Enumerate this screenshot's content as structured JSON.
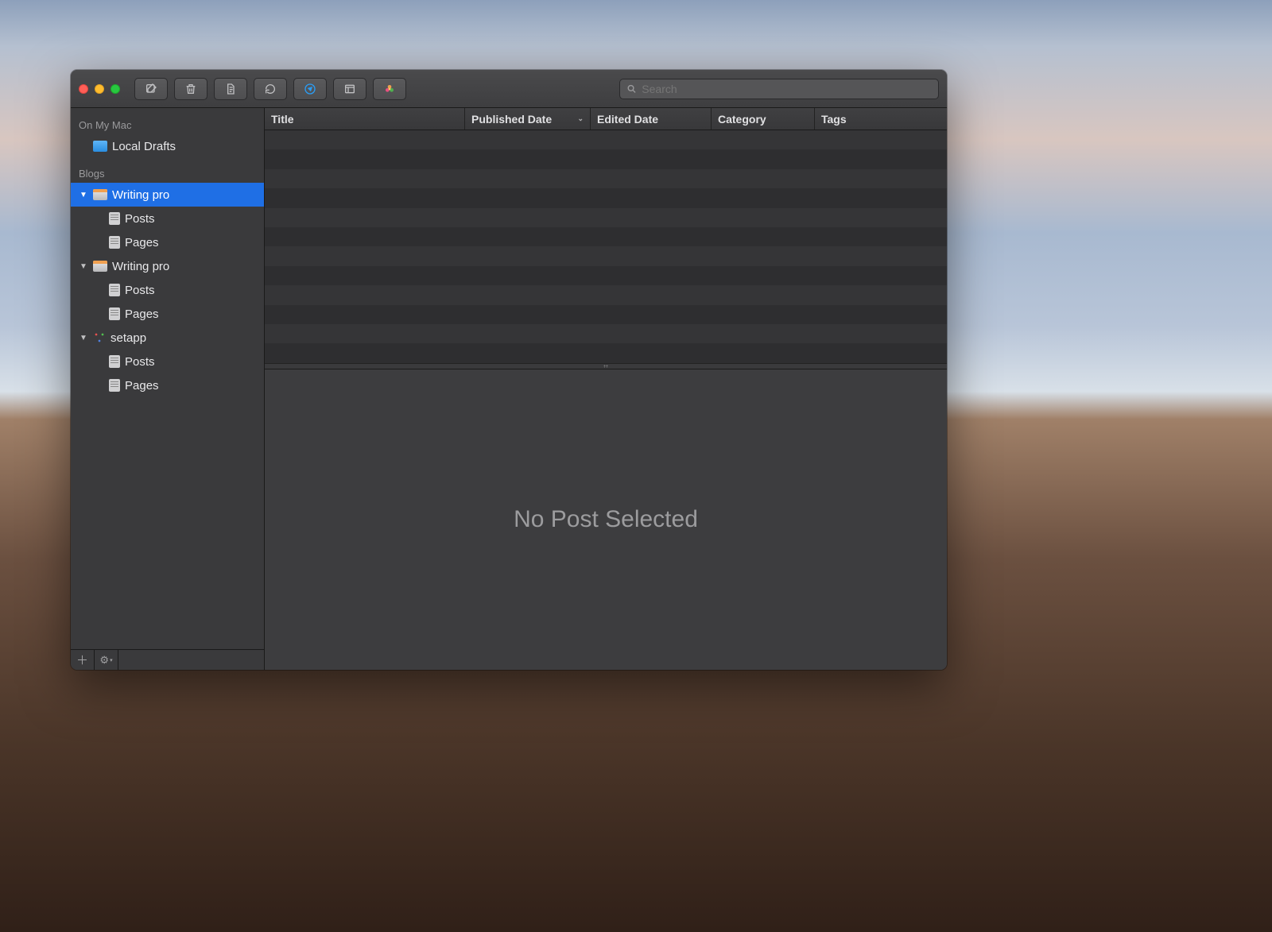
{
  "search": {
    "placeholder": "Search"
  },
  "sidebar": {
    "sections": [
      {
        "header": "On My Mac",
        "items": [
          {
            "label": "Local Drafts",
            "iconType": "folder"
          }
        ]
      },
      {
        "header": "Blogs",
        "items": [
          {
            "label": "Writing pro",
            "iconType": "blog",
            "expanded": true,
            "selected": true,
            "children": [
              {
                "label": "Posts"
              },
              {
                "label": "Pages"
              }
            ]
          },
          {
            "label": "Writing pro",
            "iconType": "blog",
            "expanded": true,
            "selected": false,
            "children": [
              {
                "label": "Posts"
              },
              {
                "label": "Pages"
              }
            ]
          },
          {
            "label": "setapp",
            "iconType": "setapp",
            "expanded": true,
            "selected": false,
            "children": [
              {
                "label": "Posts"
              },
              {
                "label": "Pages"
              }
            ]
          }
        ]
      }
    ]
  },
  "columns": {
    "title": "Title",
    "publishedDate": "Published Date",
    "editedDate": "Edited Date",
    "category": "Category",
    "tags": "Tags"
  },
  "detail": {
    "emptyMessage": "No Post Selected"
  }
}
